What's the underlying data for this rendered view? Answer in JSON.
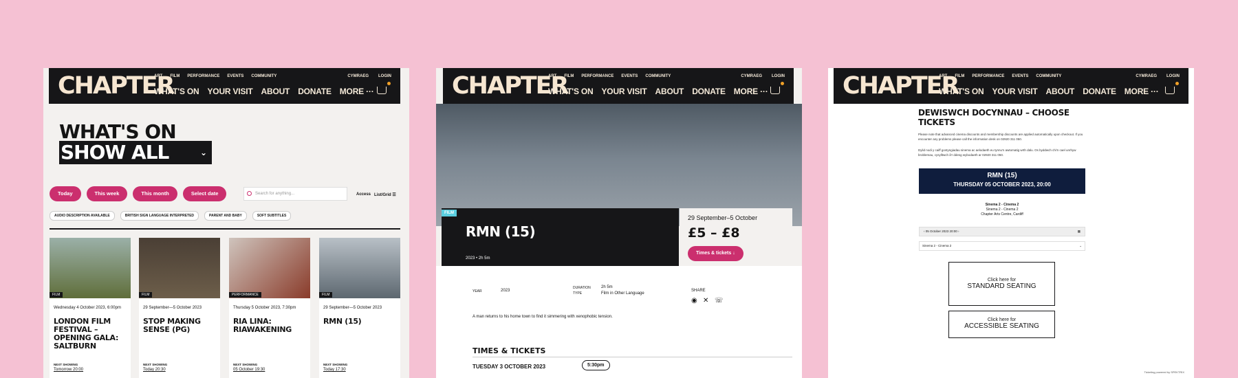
{
  "header": {
    "logo": "CHAPTER",
    "top_links": [
      "ART",
      "FILM",
      "PERFORMANCE",
      "EVENTS",
      "COMMUNITY"
    ],
    "lang": "CYMRAEG",
    "login": "LOGIN",
    "main_links": [
      "WHAT'S ON",
      "YOUR VISIT",
      "ABOUT",
      "DONATE",
      "MORE ···"
    ]
  },
  "whats_on": {
    "title": "WHAT'S ON",
    "filter_value": "SHOW ALL",
    "date_filters": [
      "Today",
      "This week",
      "This month",
      "Select date"
    ],
    "search_placeholder": "Search for anything...",
    "access_label": "Access",
    "view_label": "List/Grid",
    "tags": [
      "AUDIO DESCRIPTION AVAILABLE",
      "BRITISH SIGN LANGUAGE INTERPRETED",
      "PARENT AND BABY",
      "SOFT SUBTITLES"
    ],
    "cards": [
      {
        "category": "FILM",
        "date": "Wednesday 4 October 2023, 6:00pm",
        "title": "LONDON FILM FESTIVAL – OPENING GALA: SALTBURN",
        "next_label": "NEXT SHOWING",
        "next_value": "Tomorrow 20:00",
        "color": "#5f6e3a"
      },
      {
        "category": "FILM",
        "date": "29 September—5 October 2023",
        "title": "STOP MAKING SENSE (PG)",
        "next_label": "NEXT SHOWING",
        "next_value": "Today 20:30",
        "color": "#6d5e4a"
      },
      {
        "category": "PERFORMANCE",
        "date": "Thursday 5 October 2023, 7:30pm",
        "title": "RIA LINA: RIAWAKENING",
        "next_label": "NEXT SHOWING",
        "next_value": "05 October 19:30",
        "color": "#9a6b5a"
      },
      {
        "category": "FILM",
        "date": "29 September—5 October 2023",
        "title": "RMN (15)",
        "next_label": "NEXT SHOWING",
        "next_value": "Today 17:30",
        "color": "#7d8890"
      }
    ]
  },
  "film": {
    "category": "FILM",
    "title": "RMN (15)",
    "meta": "2023  •  2h 5m",
    "dates": "29 September–5 October",
    "price": "£5 – £8",
    "tickets_button": "Times & tickets",
    "year_label": "YEAR",
    "year_value": "2023",
    "duration_label": "DURATION",
    "duration_value": "2h 5m",
    "type_label": "TYPE",
    "type_value": "Film in Other Language",
    "share_label": "SHARE",
    "synopsis": "A man returns to his home town to find it simmering with xenophobic tension.",
    "times_heading": "TIMES & TICKETS",
    "show_date": "TUESDAY 3 OCTOBER 2023",
    "show_time": "5:30pm"
  },
  "booking": {
    "title": "DEWISWCH DOCYNNAU – CHOOSE TICKETS",
    "para_en": "Please note that advanced cinema discounts and membership discounts are applied automatically upon checkout. If you encounter any problems please call the information desk on 02920 311 050.",
    "para_cy": "Dylid nodi y caiff gostyngiadau sinema ac aelodaeth eu tynnu'n awtomatig wrth dalu. Os byddwch chi'n cael unrhyw broblemau, cysylltwch â'r ddesg wybodaeth ar 02920 311 050.",
    "film_title": "RMN (15)",
    "film_date": "THURSDAY 05 OCTOBER 2023, 20:00",
    "screen": "Sinema 2 - Cinema 2",
    "screen2": "Sinema 2 - Cinema 2",
    "venue": "Chapter Arts Centre, Cardiff",
    "date_select": "05 October 2023 20:00",
    "screen_select": "Sinema 2 - Cinema 2",
    "standard_small": "Click here for",
    "standard_big": "STANDARD SEATING",
    "accessible_small": "Click here for",
    "accessible_big": "ACCESSIBLE SEATING",
    "powered": "Ticketing powered by SPEKTRIX"
  }
}
